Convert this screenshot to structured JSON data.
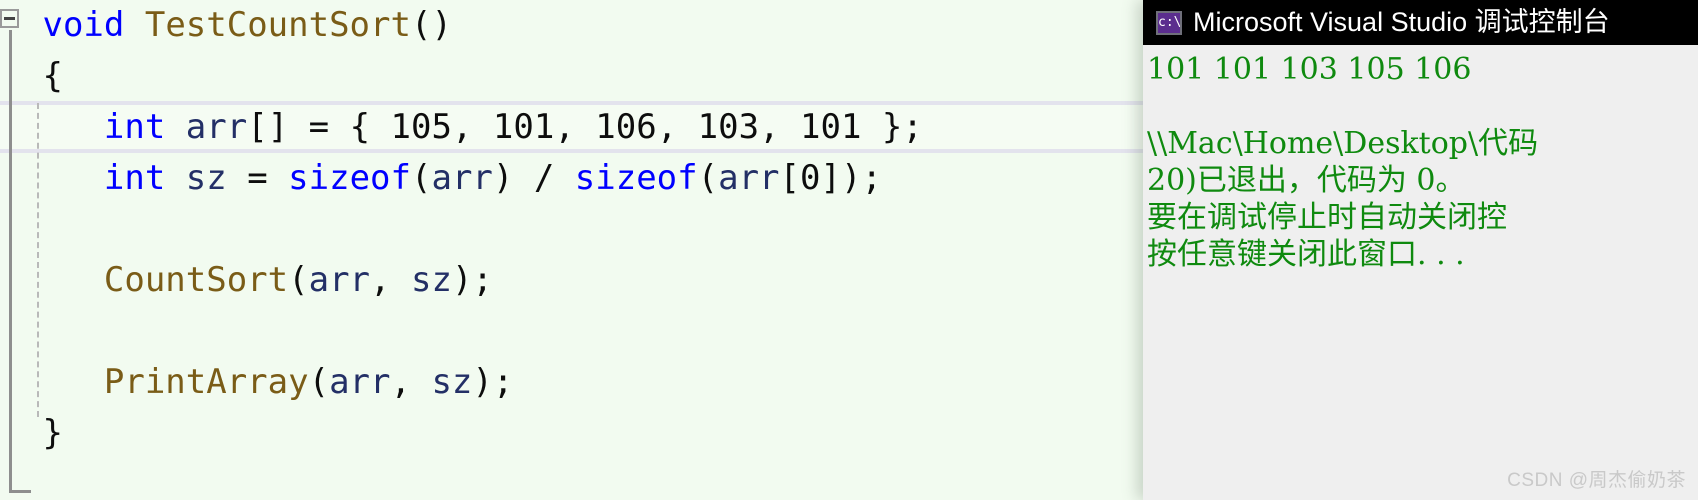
{
  "editor": {
    "name": "visual-studio-code-editor",
    "background_color": "#f2fbf0",
    "current_line_index": 2,
    "current_line_border_color": "#e3e3ed",
    "outlining": {
      "collapse_glyph": "minus",
      "collapse_tooltip": "Collapse"
    },
    "syntax_colors": {
      "keyword": "#0000ff",
      "function": "#7a5c17",
      "identifier": "#232f66",
      "punctuation": "#0d0d0d",
      "number": "#0d0d0d"
    },
    "lines": [
      {
        "indent": 0,
        "tokens": [
          {
            "t": "void",
            "c": "kw"
          },
          {
            "t": " ",
            "c": "pn"
          },
          {
            "t": "TestCountSort",
            "c": "fn"
          },
          {
            "t": "()",
            "c": "pn"
          }
        ]
      },
      {
        "indent": 0,
        "tokens": [
          {
            "t": "{",
            "c": "pn"
          }
        ]
      },
      {
        "indent": 2,
        "tokens": [
          {
            "t": "int",
            "c": "kw"
          },
          {
            "t": " ",
            "c": "pn"
          },
          {
            "t": "arr",
            "c": "id"
          },
          {
            "t": "[] = { ",
            "c": "pn"
          },
          {
            "t": "105",
            "c": "num"
          },
          {
            "t": ", ",
            "c": "pn"
          },
          {
            "t": "101",
            "c": "num"
          },
          {
            "t": ", ",
            "c": "pn"
          },
          {
            "t": "106",
            "c": "num"
          },
          {
            "t": ", ",
            "c": "pn"
          },
          {
            "t": "103",
            "c": "num"
          },
          {
            "t": ", ",
            "c": "pn"
          },
          {
            "t": "101",
            "c": "num"
          },
          {
            "t": " };",
            "c": "pn"
          }
        ]
      },
      {
        "indent": 2,
        "tokens": [
          {
            "t": "int",
            "c": "kw"
          },
          {
            "t": " ",
            "c": "pn"
          },
          {
            "t": "sz",
            "c": "id"
          },
          {
            "t": " = ",
            "c": "pn"
          },
          {
            "t": "sizeof",
            "c": "kw"
          },
          {
            "t": "(",
            "c": "pn"
          },
          {
            "t": "arr",
            "c": "id"
          },
          {
            "t": ") / ",
            "c": "pn"
          },
          {
            "t": "sizeof",
            "c": "kw"
          },
          {
            "t": "(",
            "c": "pn"
          },
          {
            "t": "arr",
            "c": "id"
          },
          {
            "t": "[",
            "c": "pn"
          },
          {
            "t": "0",
            "c": "num"
          },
          {
            "t": "]);",
            "c": "pn"
          }
        ]
      },
      {
        "indent": 0,
        "tokens": []
      },
      {
        "indent": 2,
        "tokens": [
          {
            "t": "CountSort",
            "c": "fn"
          },
          {
            "t": "(",
            "c": "pn"
          },
          {
            "t": "arr",
            "c": "id"
          },
          {
            "t": ", ",
            "c": "pn"
          },
          {
            "t": "sz",
            "c": "id"
          },
          {
            "t": ");",
            "c": "pn"
          }
        ]
      },
      {
        "indent": 0,
        "tokens": []
      },
      {
        "indent": 2,
        "tokens": [
          {
            "t": "PrintArray",
            "c": "fn"
          },
          {
            "t": "(",
            "c": "pn"
          },
          {
            "t": "arr",
            "c": "id"
          },
          {
            "t": ", ",
            "c": "pn"
          },
          {
            "t": "sz",
            "c": "id"
          },
          {
            "t": ");",
            "c": "pn"
          }
        ]
      },
      {
        "indent": 0,
        "tokens": [
          {
            "t": "}",
            "c": "pn"
          }
        ]
      }
    ],
    "plain_lines": [
      "void TestCountSort()",
      "{",
      "    int arr[] = { 105, 101, 106, 103, 101 };",
      "    int sz = sizeof(arr) / sizeof(arr[0]);",
      "",
      "    CountSort(arr, sz);",
      "",
      "    PrintArray(arr, sz);",
      "}"
    ]
  },
  "console": {
    "title": "Microsoft Visual Studio 调试控制台",
    "icon_name": "command-prompt-icon",
    "icon_glyph": "c:\\",
    "titlebar_color": "#000000",
    "title_text_color": "#ffffff",
    "body_background": "#efefef",
    "body_text_color": "#0f8a0f",
    "output_lines": [
      "101 101 103 105 106",
      "",
      "\\\\Mac\\Home\\Desktop\\代码",
      "20)已退出，代码为 0。",
      "要在调试停止时自动关闭控",
      "按任意键关闭此窗口. . ."
    ]
  },
  "watermark": {
    "text": "CSDN @周杰偷奶茶"
  }
}
